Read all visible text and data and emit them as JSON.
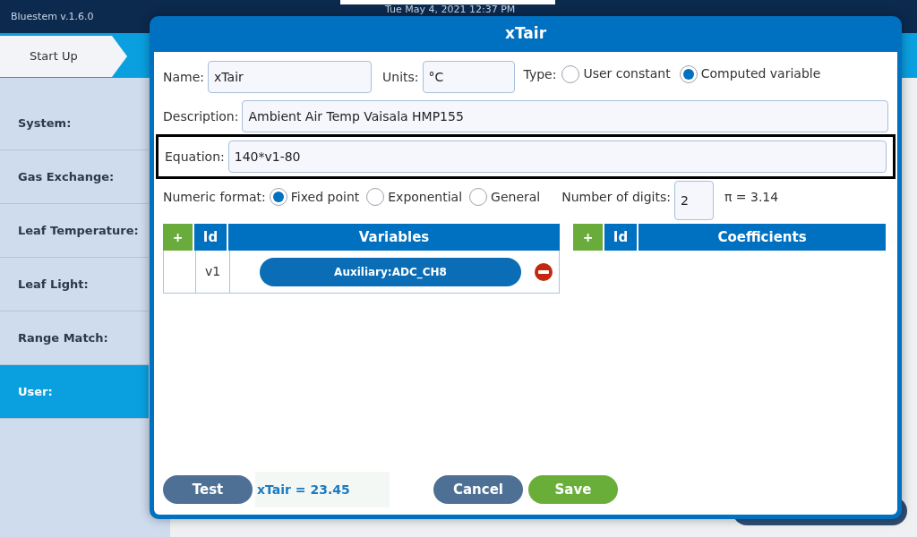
{
  "app": {
    "version": "Bluestem v.1.6.0",
    "datetime": "Tue May 4, 2021 12:37 PM"
  },
  "breadcrumb": {
    "label": "Start Up"
  },
  "sidebar": {
    "items": [
      {
        "label": "System:",
        "selected": false
      },
      {
        "label": "Gas Exchange:",
        "selected": false
      },
      {
        "label": "Leaf Temperature:",
        "selected": false
      },
      {
        "label": "Leaf Light:",
        "selected": false
      },
      {
        "label": "Range Match:",
        "selected": false
      },
      {
        "label": "User:",
        "selected": true
      }
    ]
  },
  "dialog": {
    "title": "xTair",
    "name_label": "Name:",
    "name_value": "xTair",
    "units_label": "Units:",
    "units_value": "°C",
    "type_label": "Type:",
    "type_options": [
      {
        "label": "User constant",
        "selected": false
      },
      {
        "label": "Computed variable",
        "selected": true
      }
    ],
    "description_label": "Description:",
    "description_value": "Ambient Air Temp Vaisala HMP155",
    "equation_label": "Equation:",
    "equation_value": "140*v1-80",
    "format_label": "Numeric format:",
    "format_options": [
      {
        "label": "Fixed point",
        "selected": true
      },
      {
        "label": "Exponential",
        "selected": false
      },
      {
        "label": "General",
        "selected": false
      }
    ],
    "digits_label": "Number of digits:",
    "digits_value": "2",
    "pi_preview": "π = 3.14",
    "variables_table": {
      "add": "+",
      "columns": [
        "Id",
        "Variables"
      ],
      "rows": [
        {
          "id": "v1",
          "variable": "Auxiliary:ADC_CH8"
        }
      ]
    },
    "coefficients_table": {
      "add": "+",
      "columns": [
        "Id",
        "Coefficients"
      ]
    },
    "test_button": "Test",
    "test_result": "xTair = 23.45",
    "cancel_button": "Cancel",
    "save_button": "Save"
  }
}
